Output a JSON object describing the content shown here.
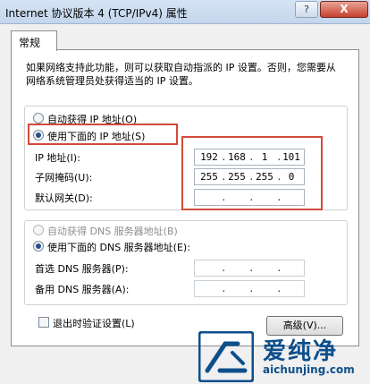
{
  "window": {
    "title": "Internet 协议版本 4 (TCP/IPv4) 属性",
    "help_label": "?",
    "close_label": "X"
  },
  "tab": {
    "label": "常规"
  },
  "description": "如果网络支持此功能，则可以获取自动指派的 IP 设置。否则，您需要从网络系统管理员处获得适当的 IP 设置。",
  "ip_section": {
    "auto_option": "自动获得 IP 地址(O)",
    "manual_option": "使用下面的 IP 地址(S)",
    "selected": "manual",
    "fields": [
      {
        "label": "IP 地址(I):",
        "octets": [
          "192",
          "168",
          "1",
          "101"
        ]
      },
      {
        "label": "子网掩码(U):",
        "octets": [
          "255",
          "255",
          "255",
          "0"
        ]
      },
      {
        "label": "默认网关(D):",
        "octets": [
          "",
          "",
          "",
          ""
        ]
      }
    ]
  },
  "dns_section": {
    "auto_option": "自动获得 DNS 服务器地址(B)",
    "manual_option": "使用下面的 DNS 服务器地址(E):",
    "selected": "manual",
    "fields": [
      {
        "label": "首选 DNS 服务器(P):",
        "octets": [
          "",
          "",
          "",
          ""
        ]
      },
      {
        "label": "备用 DNS 服务器(A):",
        "octets": [
          "",
          "",
          "",
          ""
        ]
      }
    ]
  },
  "validate_checkbox": {
    "label": "退出时验证设置(L)",
    "checked": false
  },
  "advanced_button": {
    "label": "高级(V)..."
  },
  "watermark": {
    "text": "爱纯净",
    "url": "aichunjing.com"
  },
  "colors": {
    "highlight_border": "#d04a3a",
    "watermark_blue": "#0d4f8c",
    "title_bar": "#c3d6ec"
  },
  "icons": {
    "watermark_logo": "aichunjing-logo-icon"
  }
}
